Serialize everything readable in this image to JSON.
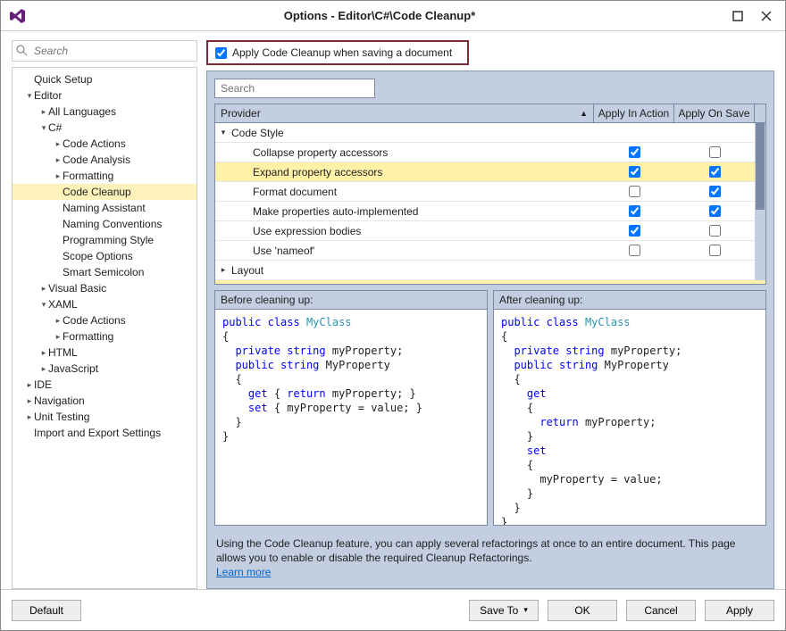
{
  "title": "Options - Editor\\C#\\Code Cleanup*",
  "sidebar_search_placeholder": "Search",
  "tree": [
    {
      "label": "Quick Setup",
      "indent": 0,
      "arrow": ""
    },
    {
      "label": "Editor",
      "indent": 0,
      "arrow": "▾"
    },
    {
      "label": "All Languages",
      "indent": 1,
      "arrow": "▸"
    },
    {
      "label": "C#",
      "indent": 1,
      "arrow": "▾"
    },
    {
      "label": "Code Actions",
      "indent": 2,
      "arrow": "▸"
    },
    {
      "label": "Code Analysis",
      "indent": 2,
      "arrow": "▸"
    },
    {
      "label": "Formatting",
      "indent": 2,
      "arrow": "▸"
    },
    {
      "label": "Code Cleanup",
      "indent": 2,
      "arrow": "",
      "selected": true
    },
    {
      "label": "Naming Assistant",
      "indent": 2,
      "arrow": ""
    },
    {
      "label": "Naming Conventions",
      "indent": 2,
      "arrow": ""
    },
    {
      "label": "Programming Style",
      "indent": 2,
      "arrow": ""
    },
    {
      "label": "Scope Options",
      "indent": 2,
      "arrow": ""
    },
    {
      "label": "Smart Semicolon",
      "indent": 2,
      "arrow": ""
    },
    {
      "label": "Visual Basic",
      "indent": 1,
      "arrow": "▸"
    },
    {
      "label": "XAML",
      "indent": 1,
      "arrow": "▾"
    },
    {
      "label": "Code Actions",
      "indent": 2,
      "arrow": "▸"
    },
    {
      "label": "Formatting",
      "indent": 2,
      "arrow": "▸"
    },
    {
      "label": "HTML",
      "indent": 1,
      "arrow": "▸"
    },
    {
      "label": "JavaScript",
      "indent": 1,
      "arrow": "▸"
    },
    {
      "label": "IDE",
      "indent": 0,
      "arrow": "▸"
    },
    {
      "label": "Navigation",
      "indent": 0,
      "arrow": "▸"
    },
    {
      "label": "Unit Testing",
      "indent": 0,
      "arrow": "▸"
    },
    {
      "label": "Import and Export Settings",
      "indent": 0,
      "arrow": ""
    }
  ],
  "apply_checkbox_label": "Apply Code Cleanup when saving a document",
  "panel_search_placeholder": "Search",
  "grid": {
    "headers": {
      "provider": "Provider",
      "action": "Apply In Action",
      "save": "Apply On Save"
    },
    "groups": [
      {
        "name": "Code Style",
        "expanded": true,
        "rows": [
          {
            "label": "Collapse property accessors",
            "action": true,
            "save": false
          },
          {
            "label": "Expand property accessors",
            "action": true,
            "save": true,
            "selected": true
          },
          {
            "label": "Format document",
            "action": false,
            "save": true
          },
          {
            "label": "Make properties auto-implemented",
            "action": true,
            "save": true
          },
          {
            "label": "Use expression bodies",
            "action": true,
            "save": false
          },
          {
            "label": "Use 'nameof'",
            "action": false,
            "save": false
          }
        ]
      },
      {
        "name": "Layout",
        "expanded": false,
        "rows": []
      }
    ]
  },
  "preview_before_title": "Before cleaning up:",
  "preview_after_title": "After cleaning up:",
  "description": "Using the Code Cleanup feature, you can apply several refactorings at once to an entire document. This page allows you to enable or disable the required Cleanup Refactorings.",
  "learn_more": "Learn more",
  "buttons": {
    "default": "Default",
    "saveto": "Save To",
    "ok": "OK",
    "cancel": "Cancel",
    "apply": "Apply"
  }
}
